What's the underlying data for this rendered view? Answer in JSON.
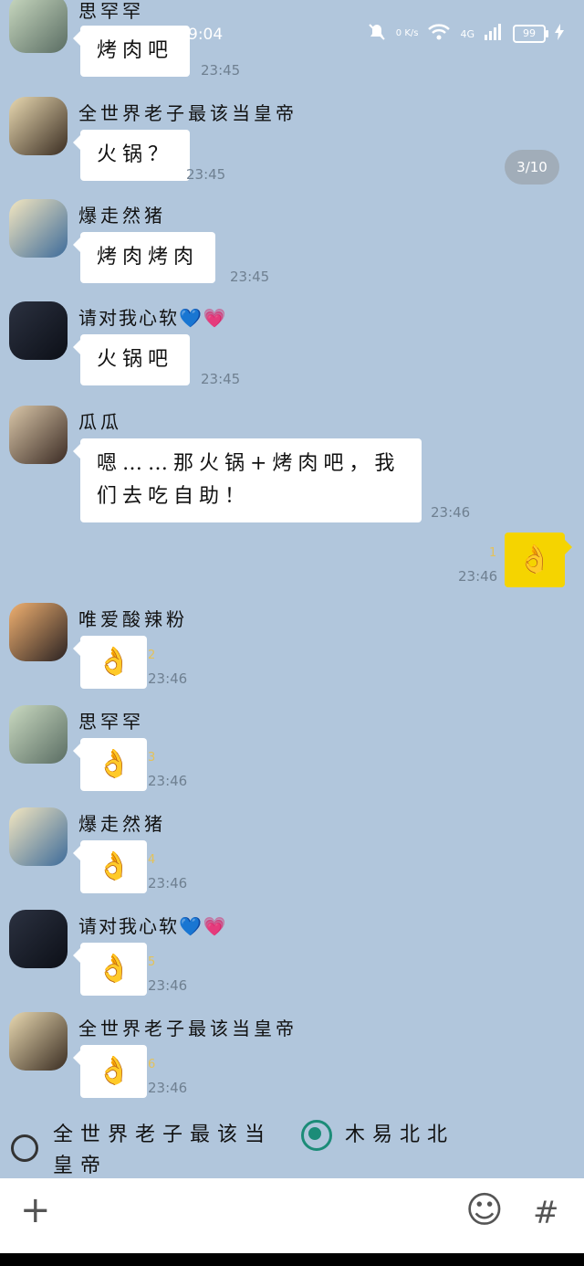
{
  "status_bar": {
    "time": "9:04",
    "net_speed": "0 K/s",
    "network": "4G",
    "battery": "99"
  },
  "page_indicator": "3/10",
  "messages": [
    {
      "sender": "思罕罕",
      "text": "烤肉吧",
      "time": "23:45"
    },
    {
      "sender": "全世界老子最该当皇帝",
      "text": "火锅？",
      "time": "23:45"
    },
    {
      "sender": "爆走然猪",
      "text": "烤肉烤肉",
      "time": "23:45"
    },
    {
      "sender": "请对我心软💙💗",
      "text": "火锅吧",
      "time": "23:45"
    },
    {
      "sender": "瓜瓜",
      "text_line1": "嗯……那火锅+烤肉吧，我",
      "text_line2": "们去吃自助！",
      "time": "23:46"
    },
    {
      "sender": "唯爱酸辣粉",
      "text": "👌",
      "seq": "2",
      "time": "23:46"
    },
    {
      "sender": "思罕罕",
      "text": "👌",
      "seq": "3",
      "time": "23:46"
    },
    {
      "sender": "爆走然猪",
      "text": "👌",
      "seq": "4",
      "time": "23:46"
    },
    {
      "sender": "请对我心软💙💗",
      "text": "👌",
      "seq": "5",
      "time": "23:46"
    },
    {
      "sender": "全世界老子最该当皇帝",
      "text": "👌",
      "seq": "6",
      "time": "23:46"
    }
  ],
  "self_message": {
    "text": "👌",
    "seq": "1",
    "time": "23:46"
  },
  "poll": {
    "option1_line1": "全世界老子最该当",
    "option1_line2": "皇帝",
    "option2": "木易北北"
  },
  "input_bar": {
    "plus": "+",
    "emoji": "☺",
    "hash": "#"
  },
  "colors": {
    "chat_bg": "#b1c6dc",
    "self_bubble": "#f5d400",
    "radio_selected": "#1c8c78"
  },
  "icons": [
    "mute-icon",
    "wifi-icon",
    "signal-icon",
    "battery-icon",
    "avatar",
    "plus-icon",
    "emoji-icon",
    "hash-icon"
  ]
}
